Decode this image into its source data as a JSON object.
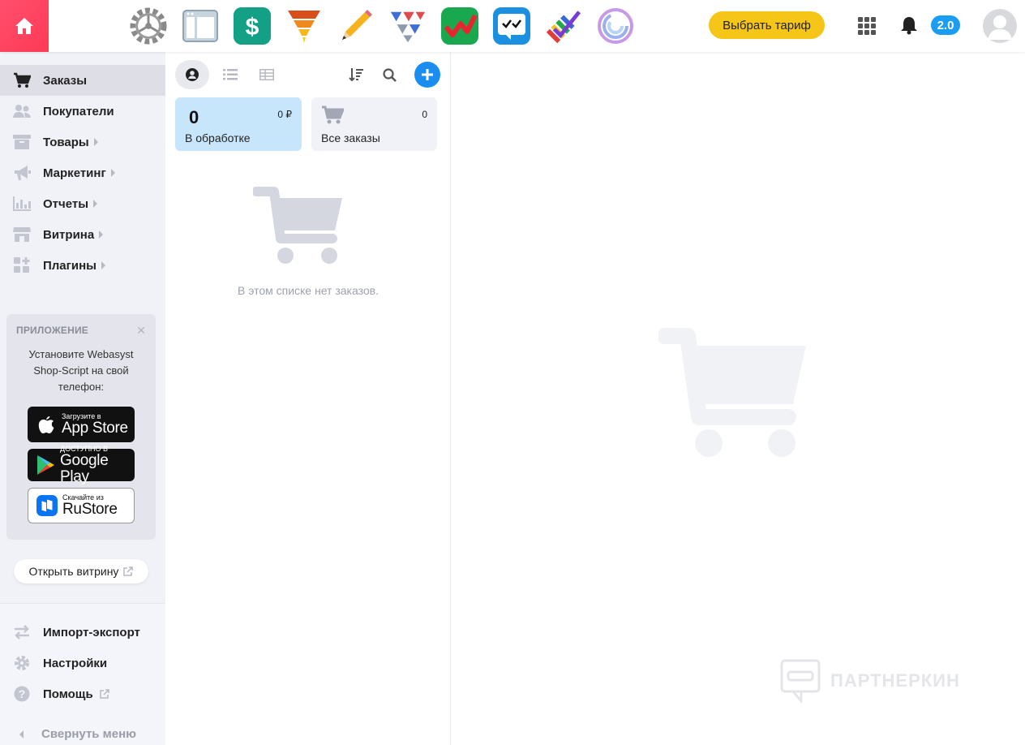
{
  "topbar": {
    "apps": [
      {
        "icon": "settings-gear-icon"
      },
      {
        "icon": "site-layout-icon"
      },
      {
        "icon": "shop-dollar-icon"
      },
      {
        "icon": "funnel-icon"
      },
      {
        "icon": "pencil-icon"
      },
      {
        "icon": "paper-planes-icon"
      },
      {
        "icon": "checkmark-green-icon"
      },
      {
        "icon": "checklist-icon"
      },
      {
        "icon": "tasks-colorful-icon"
      },
      {
        "icon": "spiral-icon"
      }
    ],
    "tariff_label": "Выбрать тариф",
    "version_badge": "2.0"
  },
  "sidebar": {
    "items": [
      {
        "label": "Заказы",
        "icon": "cart-icon",
        "active": true,
        "has_submenu": false
      },
      {
        "label": "Покупатели",
        "icon": "users-icon",
        "active": false,
        "has_submenu": false
      },
      {
        "label": "Товары",
        "icon": "box-icon",
        "active": false,
        "has_submenu": true
      },
      {
        "label": "Маркетинг",
        "icon": "megaphone-icon",
        "active": false,
        "has_submenu": true
      },
      {
        "label": "Отчеты",
        "icon": "bar-chart-icon",
        "active": false,
        "has_submenu": true
      },
      {
        "label": "Витрина",
        "icon": "storefront-icon",
        "active": false,
        "has_submenu": true
      },
      {
        "label": "Плагины",
        "icon": "plugins-icon",
        "active": false,
        "has_submenu": true
      }
    ],
    "app_promo": {
      "title": "ПРИЛОЖЕНИЕ",
      "text": "Установите Webasyst Shop-Script на свой телефон:",
      "appstore_small": "Загрузите в",
      "appstore_big": "App Store",
      "googleplay_small": "ДОСТУПНО В",
      "googleplay_big": "Google Play",
      "rustore_small": "Скачайте из",
      "rustore_big": "RuStore"
    },
    "open_shop_label": "Открыть витрину",
    "bottom_items": [
      {
        "label": "Импорт-экспорт",
        "icon": "import-export-icon"
      },
      {
        "label": "Настройки",
        "icon": "settings-icon"
      },
      {
        "label": "Помощь",
        "icon": "help-icon"
      }
    ],
    "collapse_label": "Свернуть меню"
  },
  "orders": {
    "cards": [
      {
        "count": "0",
        "sum": "0 ₽",
        "label": "В обработке"
      },
      {
        "count": "0",
        "label": "Все заказы"
      }
    ],
    "empty_text": "В этом списке нет заказов."
  },
  "watermark": "ПАРТНЕРКИН",
  "colors": {
    "home": "#ff4466",
    "accent_blue": "#1a8ef0",
    "tariff_yellow": "#f5c518",
    "sidebar_bg": "#f1f2f8",
    "card_active": "#c8e6fb"
  }
}
